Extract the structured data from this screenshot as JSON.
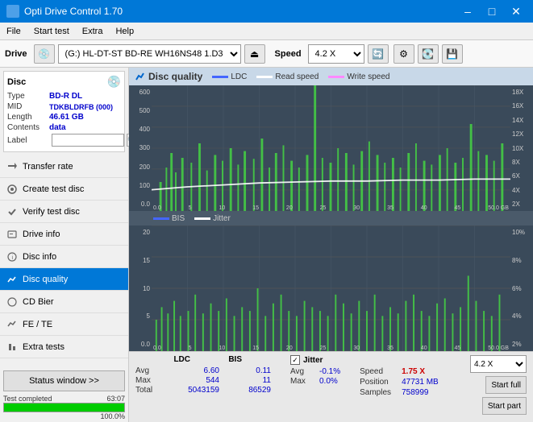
{
  "titlebar": {
    "title": "Opti Drive Control 1.70",
    "minimize": "–",
    "maximize": "□",
    "close": "✕"
  },
  "menubar": {
    "items": [
      "File",
      "Start test",
      "Extra",
      "Help"
    ]
  },
  "toolbar": {
    "drive_label": "Drive",
    "drive_value": "(G:)  HL-DT-ST BD-RE  WH16NS48 1.D3",
    "speed_label": "Speed",
    "speed_value": "4.2 X"
  },
  "disc": {
    "title": "Disc",
    "type_label": "Type",
    "type_value": "BD-R DL",
    "mid_label": "MID",
    "mid_value": "TDKBLDRFB (000)",
    "length_label": "Length",
    "length_value": "46.61 GB",
    "contents_label": "Contents",
    "contents_value": "data",
    "label_label": "Label",
    "label_value": ""
  },
  "nav": {
    "items": [
      {
        "id": "transfer-rate",
        "label": "Transfer rate",
        "active": false
      },
      {
        "id": "create-test-disc",
        "label": "Create test disc",
        "active": false
      },
      {
        "id": "verify-test-disc",
        "label": "Verify test disc",
        "active": false
      },
      {
        "id": "drive-info",
        "label": "Drive info",
        "active": false
      },
      {
        "id": "disc-info",
        "label": "Disc info",
        "active": false
      },
      {
        "id": "disc-quality",
        "label": "Disc quality",
        "active": true
      },
      {
        "id": "cd-bier",
        "label": "CD Bier",
        "active": false
      },
      {
        "id": "fe-te",
        "label": "FE / TE",
        "active": false
      },
      {
        "id": "extra-tests",
        "label": "Extra tests",
        "active": false
      }
    ]
  },
  "status": {
    "btn_label": "Status window >>",
    "status_text": "Test completed",
    "progress": 100,
    "progress_display": "100.0%",
    "time_elapsed": "63:07"
  },
  "chart": {
    "title": "Disc quality",
    "legend": [
      {
        "label": "LDC",
        "color": "#4466ff"
      },
      {
        "label": "Read speed",
        "color": "#ffffff"
      },
      {
        "label": "Write speed",
        "color": "#ff88ff"
      }
    ],
    "top": {
      "y_labels": [
        "18X",
        "16X",
        "14X",
        "12X",
        "10X",
        "8X",
        "6X",
        "4X",
        "2X"
      ],
      "y_axis": [
        600,
        500,
        400,
        300,
        200,
        100
      ],
      "x_axis": [
        0,
        5,
        10,
        15,
        20,
        25,
        30,
        35,
        40,
        45,
        "50.0 GB"
      ]
    },
    "bottom": {
      "legend": [
        {
          "label": "BIS",
          "color": "#4466ff"
        },
        {
          "label": "Jitter",
          "color": "#ffffff"
        }
      ],
      "y_labels": [
        "10%",
        "8%",
        "6%",
        "4%",
        "2%"
      ],
      "y_axis": [
        20,
        15,
        10,
        5
      ],
      "x_axis": [
        0,
        5,
        10,
        15,
        20,
        25,
        30,
        35,
        40,
        45,
        "50.0 GB"
      ]
    }
  },
  "stats": {
    "headers": [
      "LDC",
      "BIS"
    ],
    "avg_label": "Avg",
    "avg_ldc": "6.60",
    "avg_bis": "0.11",
    "max_label": "Max",
    "max_ldc": "544",
    "max_bis": "11",
    "total_label": "Total",
    "total_ldc": "5043159",
    "total_bis": "86529",
    "jitter_label": "Jitter",
    "jitter_avg": "-0.1%",
    "jitter_max": "0.0%",
    "jitter_total": "",
    "speed_label": "Speed",
    "speed_value": "1.75 X",
    "position_label": "Position",
    "position_value": "47731 MB",
    "samples_label": "Samples",
    "samples_value": "758999",
    "speed_select": "4.2 X",
    "btn_start_full": "Start full",
    "btn_start_part": "Start part"
  }
}
